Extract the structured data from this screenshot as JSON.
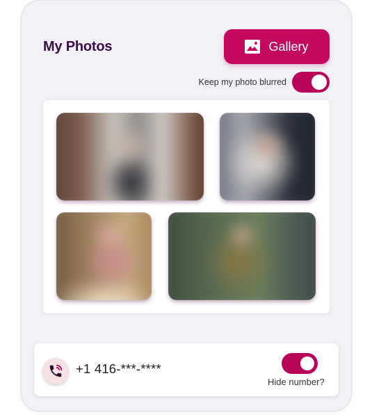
{
  "header": {
    "title": "My Photos",
    "gallery_button_label": "Gallery",
    "gallery_icon": "image-icon"
  },
  "blur_setting": {
    "label": "Keep my photo blurred",
    "enabled": true
  },
  "photos": [
    {
      "blurred": true
    },
    {
      "blurred": true
    },
    {
      "blurred": true
    },
    {
      "blurred": true
    }
  ],
  "phone": {
    "number": "+1 416-***-****",
    "icon": "phone-call-icon",
    "hide_label": "Hide number?",
    "hidden": true
  },
  "colors": {
    "accent": "#c4075f",
    "title": "#3b0c46",
    "card_background": "#f1f1f6"
  }
}
